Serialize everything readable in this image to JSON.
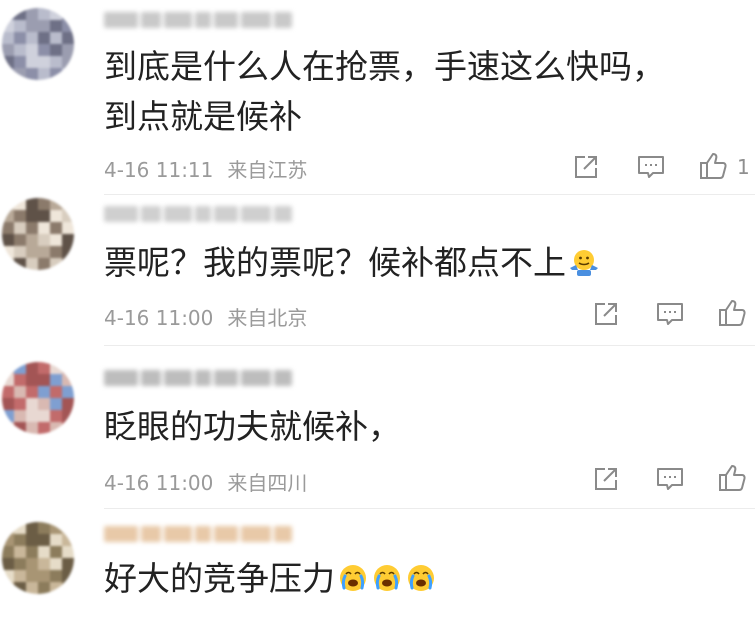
{
  "comments": [
    {
      "lines": [
        "到底是什么人在抢票，手速这么快吗，",
        "到点就是候补"
      ],
      "time": "4-16 11:11",
      "location": "来自江苏",
      "likes": "1",
      "avatar_colors": [
        "#8c8fa8",
        "#b9bccc",
        "#6e7086",
        "#cfd1dc",
        "#9b9db0"
      ],
      "username_color": "#c9c9c9"
    },
    {
      "lines": [
        "票呢？我的票呢？候补都点不上"
      ],
      "time": "4-16 11:00",
      "location": "来自北京",
      "likes": "",
      "emoji": "shrug-emoji",
      "avatar_colors": [
        "#d8cdbf",
        "#8b7a6b",
        "#efe6da",
        "#b8a998",
        "#5f5248"
      ],
      "username_color": "#cfcfcf"
    },
    {
      "lines": [
        "眨眼的功夫就候补，"
      ],
      "time": "4-16 11:00",
      "location": "来自四川",
      "likes": "",
      "avatar_colors": [
        "#d9b9b2",
        "#c26b6b",
        "#7f9fd1",
        "#e8d8d2",
        "#a35555"
      ],
      "username_color": "#bdbdbd"
    },
    {
      "lines": [
        "好大的竞争压力"
      ],
      "emoji": "crying-emoji",
      "emoji_count": 3,
      "avatar_colors": [
        "#c9b79a",
        "#8c7c5c",
        "#e6dcc8",
        "#a89574",
        "#6b5d45"
      ],
      "username_color": "#e8c9a8"
    }
  ],
  "icons": {
    "repost": "share-icon",
    "comment": "comment-icon",
    "like": "thumbs-up-icon"
  }
}
